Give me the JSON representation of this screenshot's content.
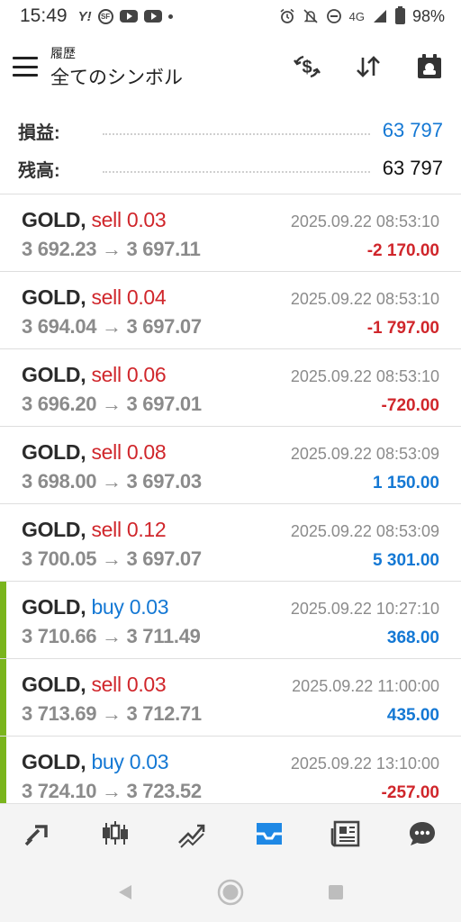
{
  "status_bar": {
    "time": "15:49",
    "network": "4G",
    "battery": "98%",
    "icons": [
      "yahoo-icon",
      "sf-icon",
      "youtube-icon",
      "youtube-icon",
      "dot-icon",
      "alarm-icon",
      "mute-icon",
      "dnd-icon",
      "signal-icon",
      "battery-icon"
    ]
  },
  "appbar": {
    "subtitle": "履歴",
    "title": "全てのシンボル",
    "actions": [
      "currency-exchange-icon",
      "sort-icon",
      "calendar-icon"
    ]
  },
  "summary": {
    "profit_label": "損益:",
    "profit_value": "63 797",
    "balance_label": "残高:",
    "balance_value": "63 797"
  },
  "trades": [
    {
      "symbol": "GOLD,",
      "side": "sell 0.03",
      "prices": "3 692.23 → 3 697.11",
      "datetime": "2025.09.22 08:53:10",
      "pl": "-2 170.00"
    },
    {
      "symbol": "GOLD,",
      "side": "sell 0.04",
      "prices": "3 694.04 → 3 697.07",
      "datetime": "2025.09.22 08:53:10",
      "pl": "-1 797.00"
    },
    {
      "symbol": "GOLD,",
      "side": "sell 0.06",
      "prices": "3 696.20 → 3 697.01",
      "datetime": "2025.09.22 08:53:10",
      "pl": "-720.00"
    },
    {
      "symbol": "GOLD,",
      "side": "sell 0.08",
      "prices": "3 698.00 → 3 697.03",
      "datetime": "2025.09.22 08:53:09",
      "pl": "1 150.00"
    },
    {
      "symbol": "GOLD,",
      "side": "sell 0.12",
      "prices": "3 700.05 → 3 697.07",
      "datetime": "2025.09.22 08:53:09",
      "pl": "5 301.00"
    },
    {
      "symbol": "GOLD,",
      "side": "buy 0.03",
      "prices": "3 710.66 → 3 711.49",
      "datetime": "2025.09.22 10:27:10",
      "pl": "368.00"
    },
    {
      "symbol": "GOLD,",
      "side": "sell 0.03",
      "prices": "3 713.69 → 3 712.71",
      "datetime": "2025.09.22 11:00:00",
      "pl": "435.00"
    },
    {
      "symbol": "GOLD,",
      "side": "buy 0.03",
      "prices": "3 724.10 → 3 723.52",
      "datetime": "2025.09.22 13:10:00",
      "pl": "-257.00"
    }
  ],
  "bottom_nav": [
    "quotes-icon",
    "chart-icon",
    "trade-icon",
    "history-icon",
    "news-icon",
    "messages-icon"
  ],
  "system_nav": [
    "back-icon",
    "home-icon",
    "recents-icon"
  ],
  "colors": {
    "sell": "#d0262b",
    "buy": "#1478d4",
    "accent_bar": "#7ab51d",
    "active_nav": "#1e88e5"
  }
}
